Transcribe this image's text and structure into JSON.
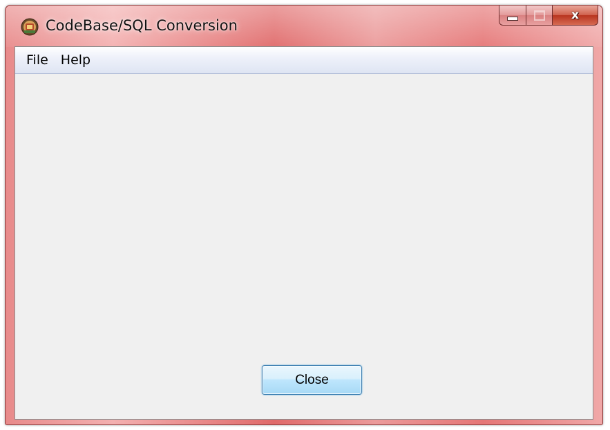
{
  "window": {
    "title": "CodeBase/SQL Conversion",
    "icon": "app-icon",
    "caption_buttons": {
      "minimize_icon": "minimize-icon",
      "maximize_icon": "maximize-icon",
      "close_label": "x"
    }
  },
  "menubar": {
    "items": [
      {
        "label": "File"
      },
      {
        "label": "Help"
      }
    ]
  },
  "main": {
    "close_button_label": "Close"
  },
  "colors": {
    "title_bar": "#e57676",
    "client_background": "#f0f0f0",
    "button_focus_border": "#3c7fb1"
  }
}
